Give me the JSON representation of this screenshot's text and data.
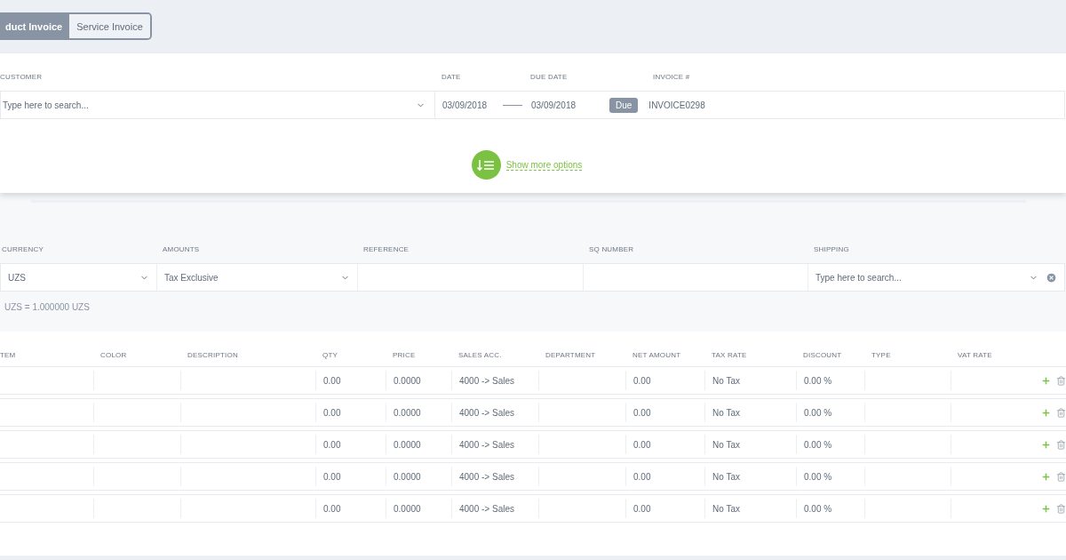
{
  "invoice_types": [
    {
      "label": "duct Invoice",
      "selected": true
    },
    {
      "label": "Service Invoice",
      "selected": false
    }
  ],
  "header": {
    "customer": {
      "label": "CUSTOMER",
      "placeholder": "Type here to search..."
    },
    "date": {
      "label": "DATE",
      "value": "03/09/2018"
    },
    "due_date": {
      "label": "DUE DATE",
      "value": "03/09/2018"
    },
    "due_badge": "Due",
    "invoice_number": {
      "label": "INVOICE #",
      "value": "INVOICE0298"
    },
    "show_more": "Show more options"
  },
  "details": {
    "fields": [
      {
        "kind": "select",
        "label": "CURRENCY",
        "value": "UZS"
      },
      {
        "kind": "select",
        "label": "AMOUNTS",
        "value": "Tax Exclusive"
      },
      {
        "kind": "text",
        "label": "REFERENCE"
      },
      {
        "kind": "text",
        "label": "SQ NUMBER"
      },
      {
        "kind": "search",
        "label": "SHIPPING",
        "placeholder": "Type here to search..."
      }
    ],
    "rate_note": "UZS = 1.000000 UZS"
  },
  "table": {
    "columns": [
      "TEM",
      "COLOR",
      "DESCRIPTION",
      "QTY",
      "PRICE",
      "SALES ACC.",
      "DEPARTMENT",
      "NET AMOUNT",
      "TAX RATE",
      "DISCOUNT",
      "TYPE",
      "VAT RATE"
    ],
    "rows": [
      {
        "cells": [
          null,
          null,
          null,
          "0.00",
          "0.0000",
          "4000 -> Sales",
          null,
          "0.00",
          "No Tax",
          "0.00 %",
          null,
          null
        ]
      },
      {
        "cells": [
          null,
          null,
          null,
          "0.00",
          "0.0000",
          "4000 -> Sales",
          null,
          "0.00",
          "No Tax",
          "0.00 %",
          null,
          null
        ]
      },
      {
        "cells": [
          null,
          null,
          null,
          "0.00",
          "0.0000",
          "4000 -> Sales",
          null,
          "0.00",
          "No Tax",
          "0.00 %",
          null,
          null
        ]
      },
      {
        "cells": [
          null,
          null,
          null,
          "0.00",
          "0.0000",
          "4000 -> Sales",
          null,
          "0.00",
          "No Tax",
          "0.00 %",
          null,
          null
        ]
      },
      {
        "cells": [
          null,
          null,
          null,
          "0.00",
          "0.0000",
          "4000 -> Sales",
          null,
          "0.00",
          "No Tax",
          "0.00 %",
          null,
          null
        ]
      }
    ]
  }
}
